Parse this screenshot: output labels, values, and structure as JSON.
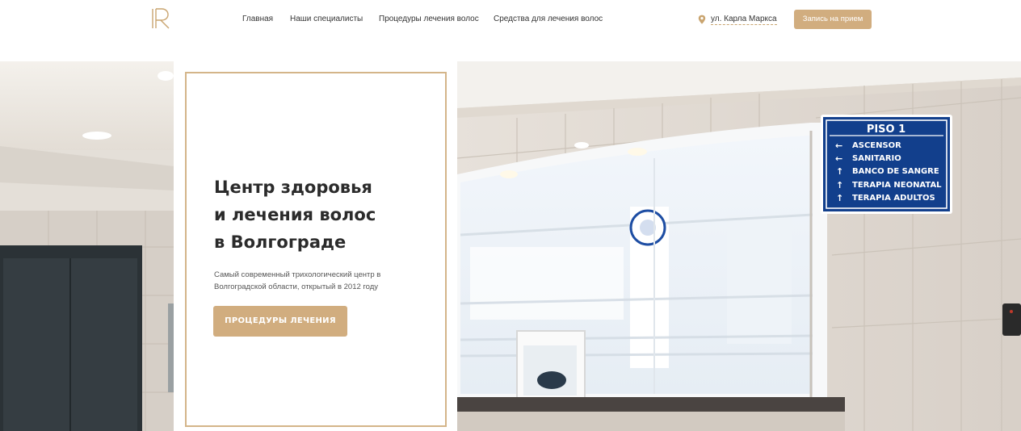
{
  "header": {
    "logo_icon": "brand-r-monogram",
    "nav": [
      {
        "label": "Главная"
      },
      {
        "label": "Наши специалисты"
      },
      {
        "label": "Процедуры лечения волос"
      },
      {
        "label": "Средства для лечения волос"
      }
    ],
    "address_icon": "map-pin-icon",
    "address": "ул. Карла Маркса",
    "appointment_button": "Запись на прием"
  },
  "hero": {
    "title_lines": [
      "Центр здоровья",
      "и лечения волос",
      "в Волгограде"
    ],
    "description_lines": [
      "Самый современный трихологический центр в",
      "Волгоградской области, открытый в 2012 году"
    ],
    "cta_button": "ПРОЦЕДУРЫ ЛЕЧЕНИЯ",
    "photo_sign": {
      "title": "PISO 1",
      "rows": [
        {
          "arrow": "left",
          "label": "ASCENSOR"
        },
        {
          "arrow": "left",
          "label": "SANITARIO"
        },
        {
          "arrow": "up",
          "label": "BANCO DE SANGRE"
        },
        {
          "arrow": "up",
          "label": "TERAPIA NEONATAL"
        },
        {
          "arrow": "up",
          "label": "TERAPIA ADULTOS"
        }
      ]
    }
  },
  "colors": {
    "accent": "#d1ad7f",
    "frame": "#d4b589",
    "text": "#2b2b2b",
    "sign_blue": "#123f8c"
  }
}
